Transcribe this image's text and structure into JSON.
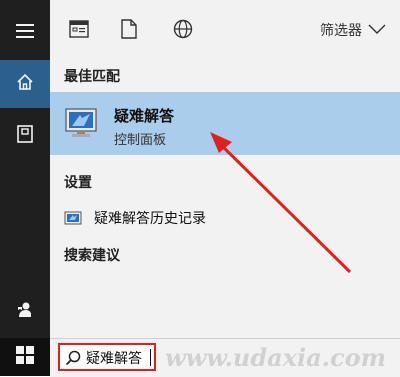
{
  "rail": {
    "icons": [
      "hamburger-icon",
      "home-icon",
      "notebook-icon",
      "feedback-icon",
      "windows-logo-icon"
    ]
  },
  "toolbar": {
    "icons": [
      "apps-icon",
      "documents-icon",
      "web-icon"
    ],
    "filter_label": "筛选器"
  },
  "sections": {
    "best_match": "最佳匹配",
    "settings": "设置",
    "suggestions": "搜索建议"
  },
  "best_match": {
    "title": "疑难解答",
    "subtitle": "控制面板",
    "icon": "troubleshoot-icon"
  },
  "settings_items": [
    {
      "label": "疑难解答历史记录",
      "icon": "history-icon"
    }
  ],
  "search": {
    "value": "疑难解答"
  },
  "watermark": "www.udaxia.com",
  "colors": {
    "rail_bg": "#1f1f1f",
    "home_accent": "#2b5f8e",
    "highlight": "#aacdec",
    "panel_bg": "#f2f2f2",
    "annotation_red": "#e02020"
  }
}
